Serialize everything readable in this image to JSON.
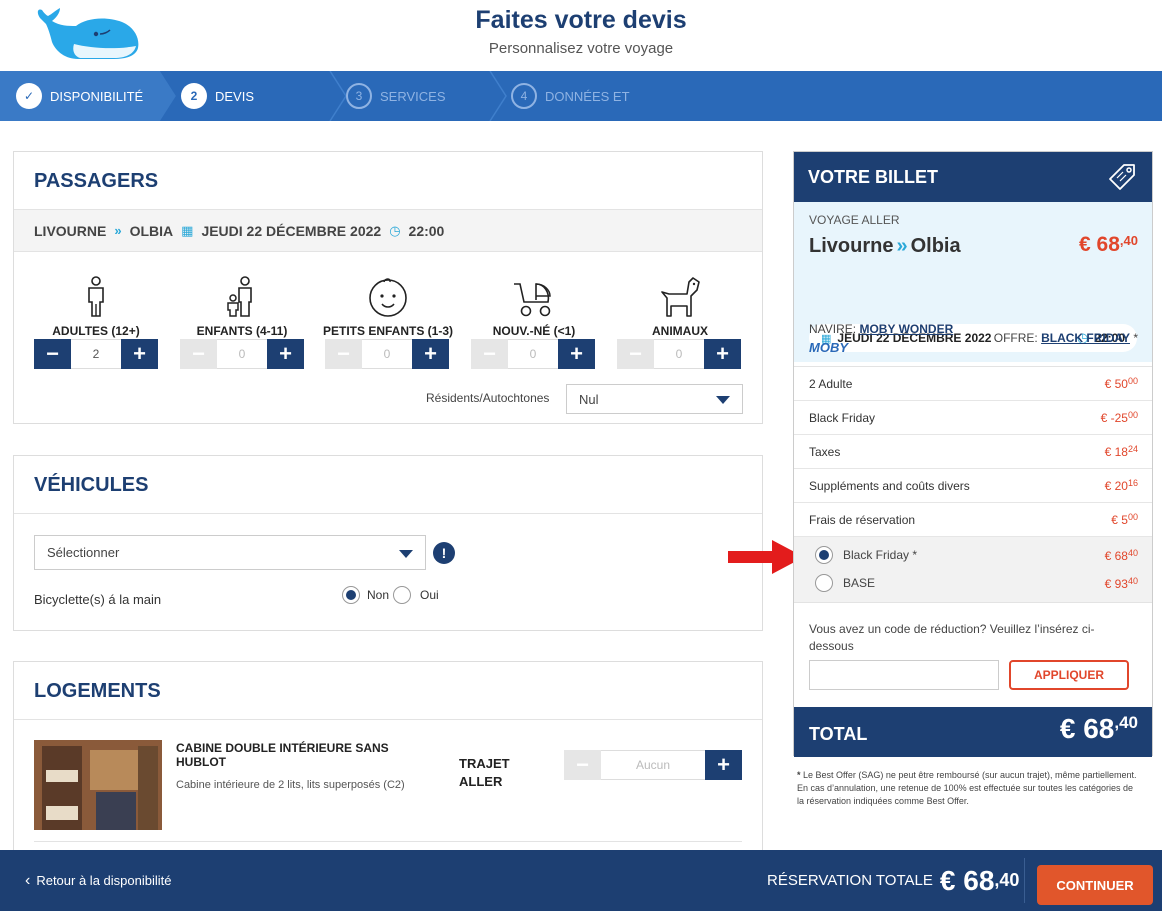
{
  "header": {
    "title": "Faites votre devis",
    "subtitle": "Personnalisez votre voyage"
  },
  "steps": [
    {
      "num": "✓",
      "label": "DISPONIBILITÉ",
      "state": "done"
    },
    {
      "num": "2",
      "label": "DEVIS",
      "state": "active"
    },
    {
      "num": "3",
      "label": "SERVICES",
      "state": "future"
    },
    {
      "num": "4",
      "label": "DONNÉES ET",
      "state": "future"
    }
  ],
  "passagers": {
    "title": "PASSAGERS",
    "from": "LIVOURNE",
    "to": "OLBIA",
    "date": "JEUDI 22 DÉCEMBRE 2022",
    "time": "22:00",
    "categories": [
      {
        "label": "ADULTES (12+)",
        "icon": "adult-icon",
        "value": "2"
      },
      {
        "label": "ENFANTS (4-11)",
        "icon": "child-icon",
        "value": "0"
      },
      {
        "label": "PETITS ENFANTS (1-3)",
        "icon": "toddler-icon",
        "value": "0"
      },
      {
        "label": "NOUV.-NÉ (<1)",
        "icon": "stroller-icon",
        "value": "0"
      },
      {
        "label": "ANIMAUX",
        "icon": "dog-icon",
        "value": "0"
      }
    ],
    "residents_label": "Résidents/Autochtones",
    "residents_value": "Nul"
  },
  "vehicules": {
    "title": "VÉHICULES",
    "select_value": "Sélectionner",
    "bicycle_label": "Bicyclette(s) á la main",
    "option_no": "Non",
    "option_yes": "Oui"
  },
  "logements": {
    "title": "LOGEMENTS",
    "cabin_title": "CABINE DOUBLE INTÉRIEURE SANS HUBLOT",
    "cabin_desc": "Cabine intérieure de 2 lits, lits superposés (C2)",
    "trajet": "TRAJET ALLER",
    "value": "Aucun"
  },
  "ticket": {
    "title": "VOTRE BILLET",
    "voyage_label": "VOYAGE ALLER",
    "from": "Livourne",
    "to": "Olbia",
    "price_main": "€ 68",
    "price_cents": ",40",
    "date": "JEUDI 22 DÉCEMBRE 2022",
    "time": "22:00",
    "navire_label": "NAVIRE:",
    "navire_name": "MOBY WONDER",
    "brand": "MOBY",
    "offre_label": "OFFRE:",
    "offre_name": "BLACK FRIDAY",
    "offre_star": "*",
    "lines": [
      {
        "label": "2 Adulte",
        "main": "€ 50",
        "cents": "00"
      },
      {
        "label": "Black Friday",
        "main": "€ -25",
        "cents": "00"
      },
      {
        "label": "Taxes",
        "main": "€ 18",
        "cents": "24"
      },
      {
        "label": "Suppléments and coûts divers",
        "main": "€ 20",
        "cents": "16"
      },
      {
        "label": "Frais de réservation",
        "main": "€ 5",
        "cents": "00"
      }
    ],
    "offers": [
      {
        "label": "Black Friday *",
        "main": "€ 68",
        "cents": "40",
        "selected": true
      },
      {
        "label": "BASE",
        "main": "€ 93",
        "cents": "40",
        "selected": false
      }
    ],
    "promo_text": "Vous avez un code de réduction? Veuillez l’insérez ci-dessous",
    "apply_label": "APPLIQUER",
    "total_label": "TOTAL",
    "total_main": "€ 68",
    "total_cents": ",40",
    "footnote_star": "*",
    "footnote": "Le Best Offer (SAG) ne peut être remboursé (sur aucun trajet), même partiellement. En cas d’annulation, une retenue de 100% est effectuée sur toutes les catégories de la réservation indiquées comme Best Offer."
  },
  "footer": {
    "back_label": "Retour à la disponibilité",
    "total_label": "RÉSERVATION TOTALE",
    "total_main": "€ 68",
    "total_cents": ",40",
    "continue_label": "CONTINUER"
  },
  "colors": {
    "navy": "#1d3f72",
    "steps_blue": "#2a69b8",
    "accent_orange": "#e1462b",
    "cyan": "#2aa8d8",
    "arrow_red": "#e31c1c"
  }
}
